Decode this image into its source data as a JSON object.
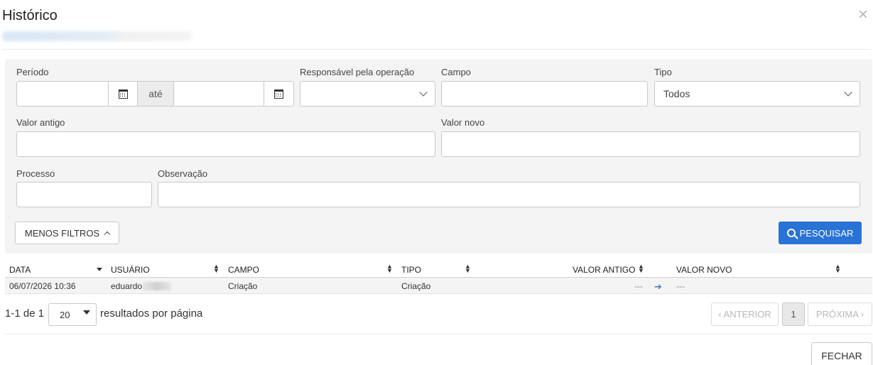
{
  "modal": {
    "title": "Histórico",
    "close_symbol": "×"
  },
  "filters": {
    "periodo_label": "Período",
    "ate_label": "até",
    "responsavel_label": "Responsável pela operação",
    "campo_label": "Campo",
    "tipo_label": "Tipo",
    "tipo_value": "Todos",
    "valor_antigo_label": "Valor antigo",
    "valor_novo_label": "Valor novo",
    "processo_label": "Processo",
    "observacao_label": "Observação",
    "menos_filtros_label": "MENOS FILTROS",
    "pesquisar_label": "PESQUISAR"
  },
  "table": {
    "columns": [
      "DATA",
      "USUÁRIO",
      "CAMPO",
      "TIPO",
      "VALOR ANTIGO",
      "VALOR NOVO"
    ],
    "rows": [
      {
        "data": "06/07/2026 10:36",
        "usuario": "eduardo",
        "campo": "Criação",
        "tipo": "Criação",
        "valor_antigo": "---",
        "valor_novo": "---"
      }
    ]
  },
  "pagination": {
    "range_text": "1-1 de 1",
    "per_page_value": "20",
    "per_page_suffix": "resultados por página",
    "prev_label": "‹ ANTERIOR",
    "current_page": "1",
    "next_label": "PRÓXIMA ›"
  },
  "footer": {
    "fechar_label": "FECHAR"
  },
  "icons": {
    "calendar": "calendar-icon",
    "chevron_down": "chevron-down-icon",
    "search": "search-icon",
    "arrow_right": "arrow-right-icon",
    "sort": "sort-icon"
  },
  "colors": {
    "primary_button": "#2a73d6",
    "filter_panel_bg": "#f4f4f4"
  }
}
